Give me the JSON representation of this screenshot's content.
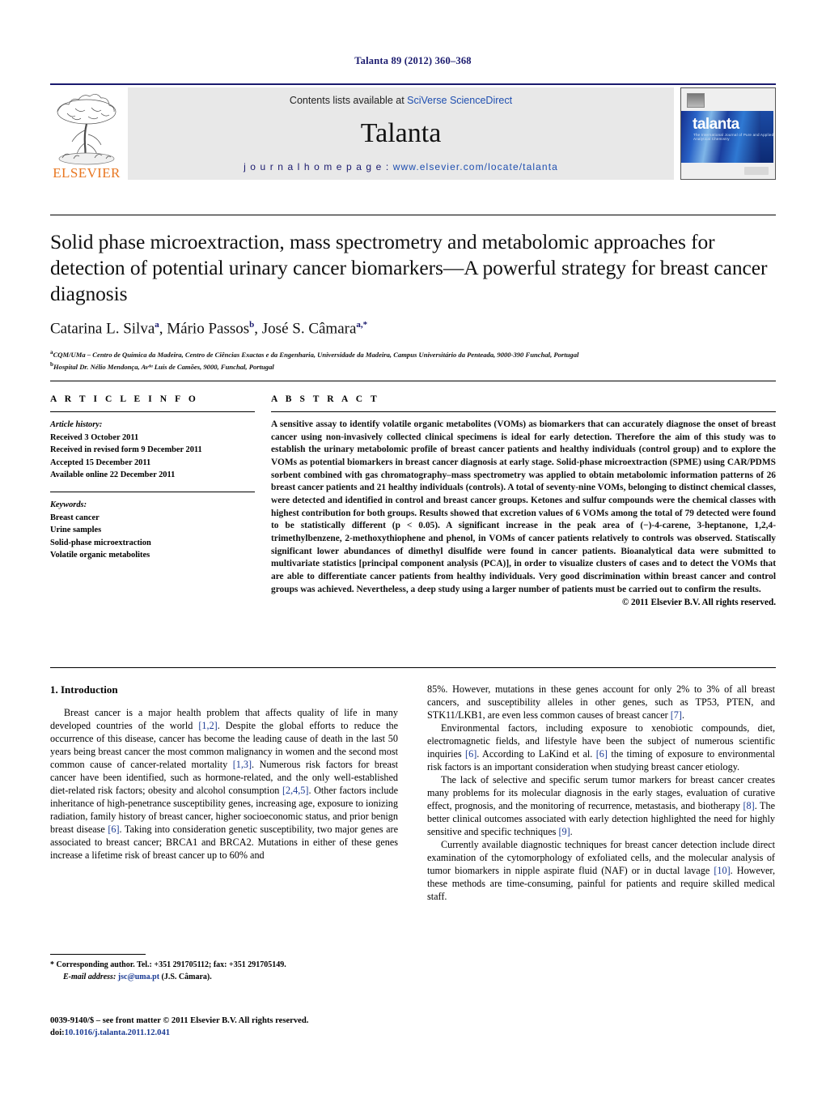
{
  "header": {
    "journal_ref": "Talanta 89 (2012) 360–368",
    "contents_prefix": "Contents lists available at ",
    "contents_link": "SciVerse ScienceDirect",
    "journal_name": "Talanta",
    "homepage_prefix": "j o u r n a l   h o m e p a g e :   ",
    "homepage_url": "www.elsevier.com/locate/talanta",
    "publisher": "ELSEVIER",
    "cover_title": "talanta",
    "cover_subtitle": "The International Journal of Pure and Applied Analytical Chemistry"
  },
  "article": {
    "title": "Solid phase microextraction, mass spectrometry and metabolomic approaches for detection of potential urinary cancer biomarkers—A powerful strategy for breast cancer diagnosis",
    "authors": "Catarina L. Silva, Mário Passos, José S. Câmara",
    "author_list": [
      {
        "name": "Catarina L. Silva",
        "sup": "a"
      },
      {
        "name": "Mário Passos",
        "sup": "b"
      },
      {
        "name": "José S. Câmara",
        "sup": "a,*"
      }
    ],
    "affiliations": [
      {
        "marker": "a",
        "text": "CQM/UMa – Centro de Química da Madeira, Centro de Ciências Exactas e da Engenharia, Universidade da Madeira, Campus Universitário da Penteada, 9000-390 Funchal, Portugal"
      },
      {
        "marker": "b",
        "text": "Hospital Dr. Nélio Mendonça, Avᵈᵃ Luís de Camões, 9000, Funchal, Portugal"
      }
    ]
  },
  "article_info": {
    "caption": "A R T I C L E   I N F O",
    "history_label": "Article history:",
    "history": [
      "Received 3 October 2011",
      "Received in revised form 9 December 2011",
      "Accepted 15 December 2011",
      "Available online 22 December 2011"
    ],
    "keywords_label": "Keywords:",
    "keywords": [
      "Breast cancer",
      "Urine samples",
      "Solid-phase microextraction",
      "Volatile organic metabolites"
    ]
  },
  "abstract": {
    "caption": "A B S T R A C T",
    "text": "A sensitive assay to identify volatile organic metabolites (VOMs) as biomarkers that can accurately diagnose the onset of breast cancer using non-invasively collected clinical specimens is ideal for early detection. Therefore the aim of this study was to establish the urinary metabolomic profile of breast cancer patients and healthy individuals (control group) and to explore the VOMs as potential biomarkers in breast cancer diagnosis at early stage. Solid-phase microextraction (SPME) using CAR/PDMS sorbent combined with gas chromatography–mass spectrometry was applied to obtain metabolomic information patterns of 26 breast cancer patients and 21 healthy individuals (controls). A total of seventy-nine VOMs, belonging to distinct chemical classes, were detected and identified in control and breast cancer groups. Ketones and sulfur compounds were the chemical classes with highest contribution for both groups. Results showed that excretion values of 6 VOMs among the total of 79 detected were found to be statistically different (p < 0.05). A significant increase in the peak area of (−)-4-carene, 3-heptanone, 1,2,4-trimethylbenzene, 2-methoxythiophene and phenol, in VOMs of cancer patients relatively to controls was observed. Statiscally significant lower abundances of dimethyl disulfide were found in cancer patients. Bioanalytical data were submitted to multivariate statistics [principal component analysis (PCA)], in order to visualize clusters of cases and to detect the VOMs that are able to differentiate cancer patients from healthy individuals. Very good discrimination within breast cancer and control groups was achieved. Nevertheless, a deep study using a larger number of patients must be carried out to confirm the results.",
    "copyright": "© 2011 Elsevier B.V. All rights reserved."
  },
  "introduction": {
    "heading": "1.  Introduction",
    "left_paragraphs": [
      "Breast cancer is a major health problem that affects quality of life in many developed countries of the world [1,2]. Despite the global efforts to reduce the occurrence of this disease, cancer has become the leading cause of death in the last 50 years being breast cancer the most common malignancy in women and the second most common cause of cancer-related mortality [1,3]. Numerous risk factors for breast cancer have been identified, such as hormone-related, and the only well-established diet-related risk factors; obesity and alcohol consumption [2,4,5]. Other factors include inheritance of high-penetrance susceptibility genes, increasing age, exposure to ionizing radiation, family history of breast cancer, higher socioeconomic status, and prior benign breast disease [6]. Taking into consideration genetic susceptibility, two major genes are associated to breast cancer; BRCA1 and BRCA2. Mutations in either of these genes increase a lifetime risk of breast cancer up to 60% and"
    ],
    "right_paragraphs": [
      "85%. However, mutations in these genes account for only 2% to 3% of all breast cancers, and susceptibility alleles in other genes, such as TP53, PTEN, and STK11/LKB1, are even less common causes of breast cancer [7].",
      "Environmental factors, including exposure to xenobiotic compounds, diet, electromagnetic fields, and lifestyle have been the subject of numerous scientific inquiries [6]. According to LaKind et al. [6] the timing of exposure to environmental risk factors is an important consideration when studying breast cancer etiology.",
      "The lack of selective and specific serum tumor markers for breast cancer creates many problems for its molecular diagnosis in the early stages, evaluation of curative effect, prognosis, and the monitoring of recurrence, metastasis, and biotherapy [8]. The better clinical outcomes associated with early detection highlighted the need for highly sensitive and specific techniques [9].",
      "Currently available diagnostic techniques for breast cancer detection include direct examination of the cytomorphology of exfoliated cells, and the molecular analysis of tumor biomarkers in nipple aspirate fluid (NAF) or in ductal lavage [10]. However, these methods are time-consuming, painful for patients and require skilled medical staff."
    ]
  },
  "footnote": {
    "corresponding": "* Corresponding author. Tel.: +351 291705112; fax: +351 291705149.",
    "email_label": "E-mail address:",
    "email": "jsc@uma.pt",
    "email_owner": "(J.S. Câmara).",
    "issn_line": "0039-9140/$ – see front matter © 2011 Elsevier B.V. All rights reserved.",
    "doi_label": "doi:",
    "doi": "10.1016/j.talanta.2011.12.041"
  },
  "colors": {
    "journal_blue": "#1a1a6e",
    "link_blue": "#1f4fb0",
    "ref_blue": "#1a3a93",
    "elsevier_orange": "#E87722",
    "masthead_grey": "#e8e8e8"
  }
}
